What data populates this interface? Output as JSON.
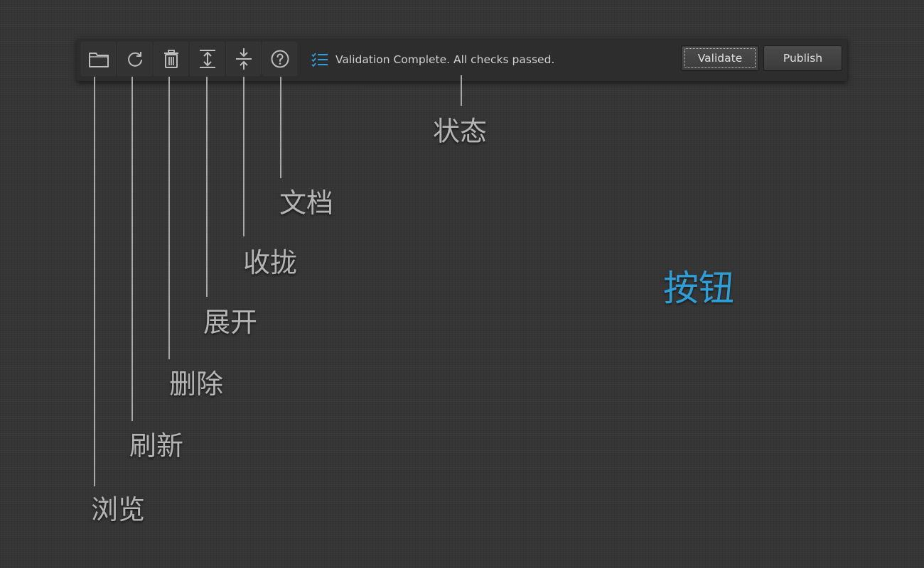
{
  "toolbar": {
    "buttons": [
      {
        "name": "browse",
        "icon": "folder-icon"
      },
      {
        "name": "refresh",
        "icon": "refresh-icon"
      },
      {
        "name": "delete",
        "icon": "trash-icon"
      },
      {
        "name": "expand",
        "icon": "expand-icon"
      },
      {
        "name": "collapse",
        "icon": "collapse-icon"
      },
      {
        "name": "docs",
        "icon": "help-icon"
      }
    ],
    "status": {
      "icon": "checklist-icon",
      "text": "Validation Complete. All checks passed."
    },
    "validate_label": "Validate",
    "publish_label": "Publish"
  },
  "annotations": {
    "browse": "浏览",
    "refresh": "刷新",
    "delete": "删除",
    "expand": "展开",
    "collapse": "收拢",
    "docs": "文档",
    "status": "状态"
  },
  "heading": "按钮",
  "colors": {
    "accent": "#2f9ed6",
    "background": "#353535",
    "toolbar": "#2d2d2d",
    "label": "#b5b5b5"
  }
}
